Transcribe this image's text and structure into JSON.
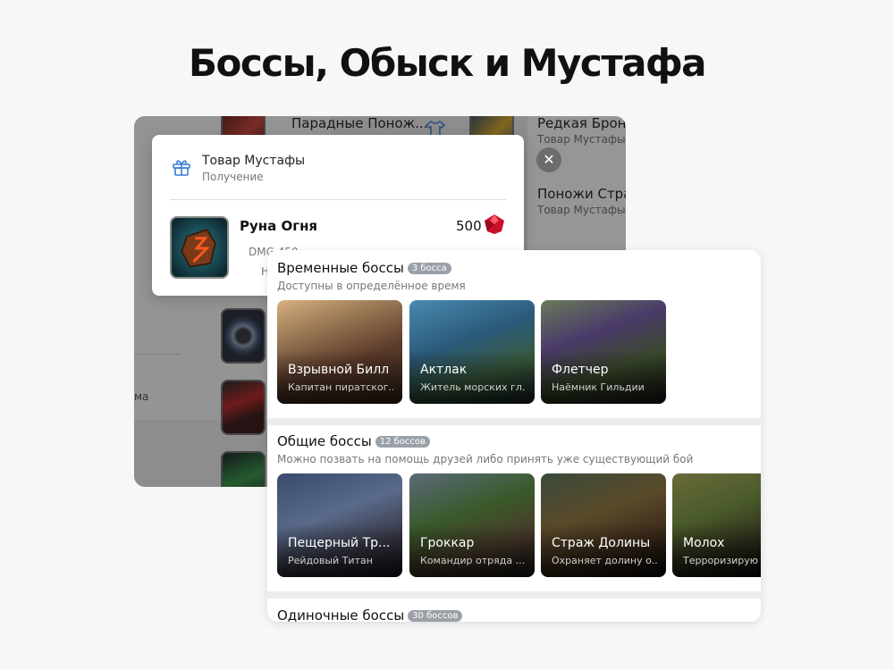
{
  "page": {
    "title": "Боссы, Обыск и Мустафа"
  },
  "back_window": {
    "items": [
      {
        "label": "Парадные Понож...",
        "sub": ""
      },
      {
        "label": "Редкая Броня",
        "sub": "Товар Мустафы"
      },
      {
        "label": "Поножи Стран",
        "sub": "Товар Мустафы"
      }
    ],
    "left_fragment": "ма",
    "icons": [
      "shirt-icon"
    ]
  },
  "popup": {
    "title": "Товар Мустафы",
    "subtitle": "Получение",
    "item_name": "Руна Огня",
    "price": "500",
    "stat_1": "DMG 450",
    "stat_2": "Н",
    "icons": [
      "gift-icon",
      "ruby-gem-icon",
      "fire-rune-icon"
    ]
  },
  "close_label": "✕",
  "bosses": {
    "temporary": {
      "title": "Временные боссы",
      "badge": "3 босса",
      "description": "Доступны в определённое время",
      "cards": [
        {
          "name": "Взрывной Билл",
          "sub": "Капитан пиратског..."
        },
        {
          "name": "Актлак",
          "sub": "Житель морских гл..."
        },
        {
          "name": "Флетчер",
          "sub": "Наёмник Гильдии"
        }
      ]
    },
    "common": {
      "title": "Общие боссы",
      "badge": "12 боссов",
      "description": "Можно позвать на помощь друзей либо принять уже существующий бой",
      "cards": [
        {
          "name": "Пещерный Тр...",
          "sub": "Рейдовый Титан"
        },
        {
          "name": "Гроккар",
          "sub": "Командир отряда ..."
        },
        {
          "name": "Страж Долины",
          "sub": "Охраняет долину о..."
        },
        {
          "name": "Молох",
          "sub": "Терроризирую"
        }
      ]
    },
    "single": {
      "title": "Одиночные боссы",
      "badge": "30 боссов"
    }
  },
  "colors": {
    "badge": "#9aa0a8",
    "accent_blue": "#3a7bd5",
    "gem_red": "#c8102e"
  }
}
